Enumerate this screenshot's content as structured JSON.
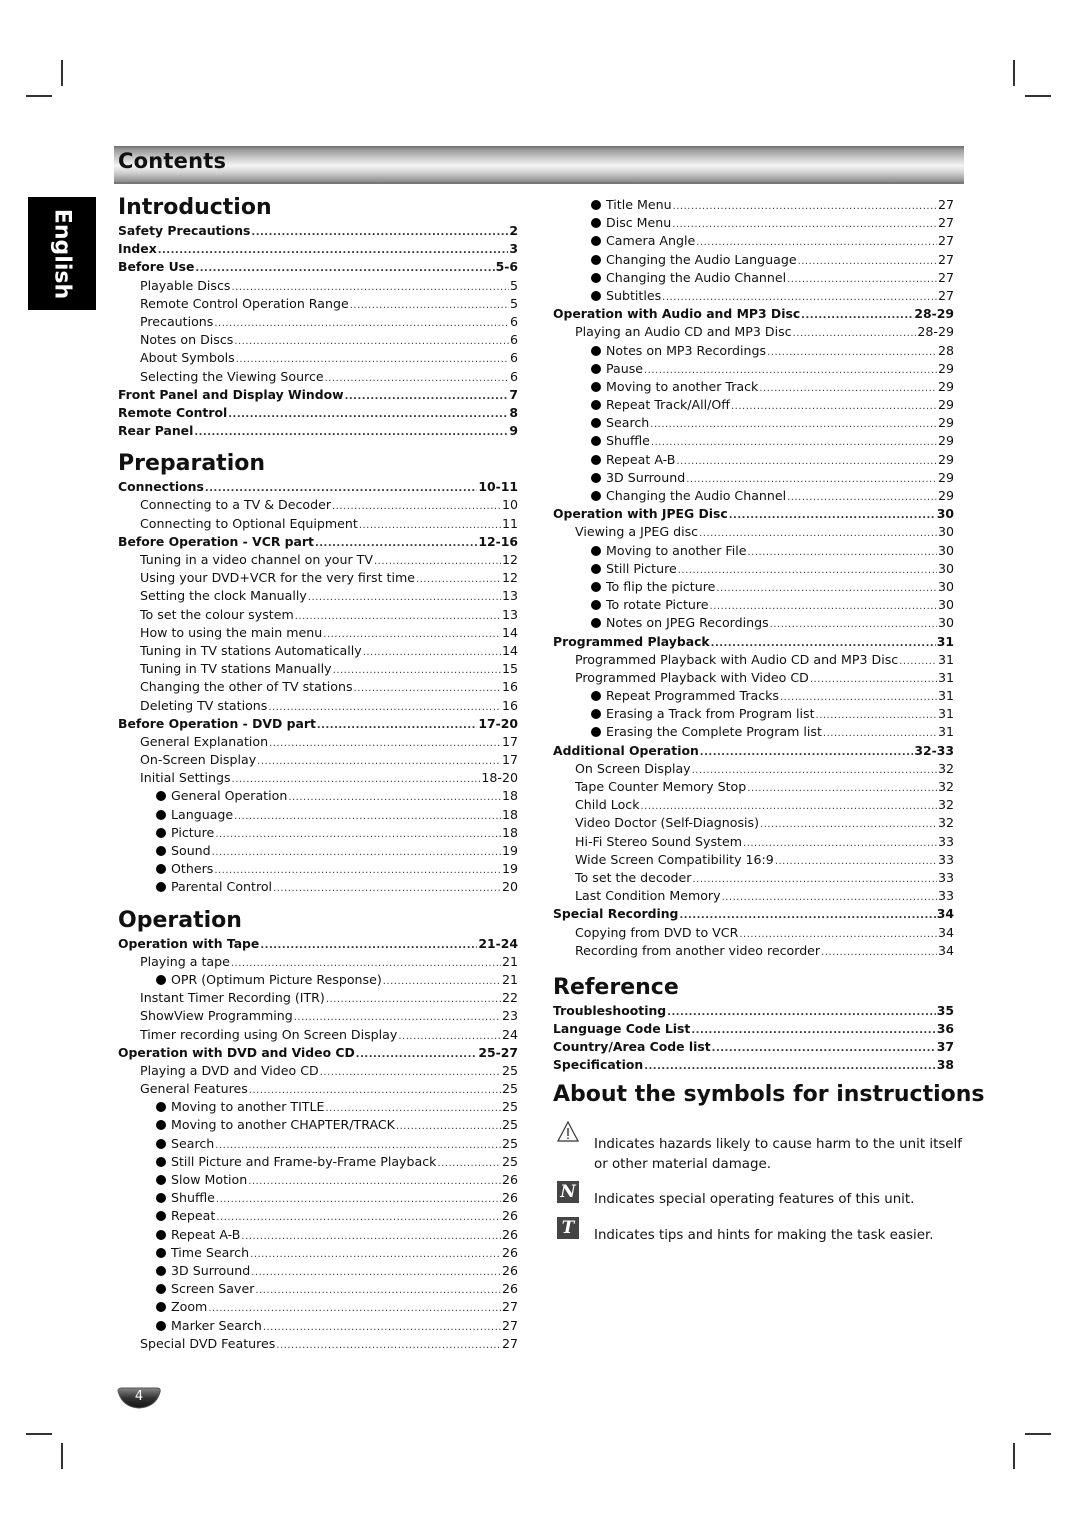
{
  "header": {
    "title": "Contents"
  },
  "language_tab": "English",
  "left_column": [
    {
      "type": "section",
      "text": "Introduction"
    },
    {
      "level": 0,
      "label": "Safety Precautions",
      "page": "2"
    },
    {
      "level": 0,
      "label": "Index",
      "page": "3"
    },
    {
      "level": 0,
      "label": "Before Use",
      "page": "5-6"
    },
    {
      "level": 1,
      "label": "Playable Discs",
      "page": "5"
    },
    {
      "level": 1,
      "label": "Remote Control Operation Range",
      "page": "5"
    },
    {
      "level": 1,
      "label": "Precautions",
      "page": "6"
    },
    {
      "level": 1,
      "label": "Notes on Discs",
      "page": "6"
    },
    {
      "level": 1,
      "label": "About Symbols",
      "page": "6"
    },
    {
      "level": 1,
      "label": "Selecting the Viewing Source",
      "page": "6"
    },
    {
      "level": 0,
      "label": "Front Panel and Display Window",
      "page": "7"
    },
    {
      "level": 0,
      "label": "Remote Control",
      "page": "8"
    },
    {
      "level": 0,
      "label": "Rear Panel",
      "page": "9"
    },
    {
      "type": "section",
      "text": "Preparation"
    },
    {
      "level": 0,
      "label": "Connections",
      "page": "10-11"
    },
    {
      "level": 1,
      "label": "Connecting to a TV & Decoder",
      "page": "10"
    },
    {
      "level": 1,
      "label": "Connecting to Optional Equipment",
      "page": "11"
    },
    {
      "level": 0,
      "label": "Before Operation - VCR part",
      "page": "12-16"
    },
    {
      "level": 1,
      "label": "Tuning in a video channel on your TV",
      "page": "12"
    },
    {
      "level": 1,
      "label": "Using your DVD+VCR for the very first time",
      "page": "12"
    },
    {
      "level": 1,
      "label": "Setting the clock Manually",
      "page": "13"
    },
    {
      "level": 1,
      "label": "To set the colour system",
      "page": "13"
    },
    {
      "level": 1,
      "label": "How to using the main menu",
      "page": "14"
    },
    {
      "level": 1,
      "label": "Tuning in TV stations Automatically",
      "page": "14"
    },
    {
      "level": 1,
      "label": "Tuning in TV stations Manually",
      "page": "15"
    },
    {
      "level": 1,
      "label": "Changing the other of TV stations",
      "page": "16"
    },
    {
      "level": 1,
      "label": "Deleting TV stations",
      "page": "16"
    },
    {
      "level": 0,
      "label": "Before Operation - DVD part",
      "page": "17-20"
    },
    {
      "level": 1,
      "label": "General Explanation",
      "page": "17"
    },
    {
      "level": 1,
      "label": "On-Screen Display",
      "page": "17"
    },
    {
      "level": 1,
      "label": "Initial Settings",
      "page": "18-20"
    },
    {
      "level": 2,
      "label": "General Operation",
      "page": "18"
    },
    {
      "level": 2,
      "label": "Language",
      "page": "18"
    },
    {
      "level": 2,
      "label": "Picture",
      "page": "18"
    },
    {
      "level": 2,
      "label": "Sound",
      "page": "19"
    },
    {
      "level": 2,
      "label": "Others",
      "page": "19"
    },
    {
      "level": 2,
      "label": "Parental Control",
      "page": "20"
    },
    {
      "type": "section",
      "text": "Operation"
    },
    {
      "level": 0,
      "label": "Operation with Tape",
      "page": "21-24"
    },
    {
      "level": 1,
      "label": "Playing a tape",
      "page": "21"
    },
    {
      "level": 2,
      "label": "OPR (Optimum Picture Response)",
      "page": "21"
    },
    {
      "level": 1,
      "label": "Instant Timer Recording (ITR)",
      "page": "22"
    },
    {
      "level": 1,
      "label": "ShowView Programming",
      "page": "23"
    },
    {
      "level": 1,
      "label": "Timer recording using On Screen Display",
      "page": "24"
    },
    {
      "level": 0,
      "label": "Operation with DVD and Video CD",
      "page": "25-27"
    },
    {
      "level": 1,
      "label": "Playing a DVD and Video CD",
      "page": "25"
    },
    {
      "level": 1,
      "label": "General Features",
      "page": "25"
    },
    {
      "level": 2,
      "label": "Moving to another TITLE",
      "page": "25"
    },
    {
      "level": 2,
      "label": "Moving to another CHAPTER/TRACK",
      "page": "25"
    },
    {
      "level": 2,
      "label": "Search",
      "page": "25"
    },
    {
      "level": 2,
      "label": "Still Picture and Frame-by-Frame Playback",
      "page": "25"
    },
    {
      "level": 2,
      "label": "Slow Motion",
      "page": "26"
    },
    {
      "level": 2,
      "label": "Shuffle",
      "page": "26"
    },
    {
      "level": 2,
      "label": "Repeat",
      "page": "26"
    },
    {
      "level": 2,
      "label": "Repeat A-B",
      "page": "26"
    },
    {
      "level": 2,
      "label": "Time Search",
      "page": "26"
    },
    {
      "level": 2,
      "label": "3D Surround",
      "page": "26"
    },
    {
      "level": 2,
      "label": "Screen Saver",
      "page": "26"
    },
    {
      "level": 2,
      "label": "Zoom",
      "page": "27"
    },
    {
      "level": 2,
      "label": "Marker Search",
      "page": "27"
    },
    {
      "level": 1,
      "label": "Special DVD Features",
      "page": "27"
    }
  ],
  "right_column": [
    {
      "level": 2,
      "label": "Title Menu",
      "page": "27"
    },
    {
      "level": 2,
      "label": "Disc Menu",
      "page": "27"
    },
    {
      "level": 2,
      "label": "Camera Angle",
      "page": "27"
    },
    {
      "level": 2,
      "label": "Changing the Audio Language",
      "page": "27"
    },
    {
      "level": 2,
      "label": "Changing the Audio Channel",
      "page": "27"
    },
    {
      "level": 2,
      "label": "Subtitles",
      "page": "27"
    },
    {
      "level": 0,
      "label": "Operation with Audio and MP3 Disc",
      "page": "28-29"
    },
    {
      "level": 1,
      "label": "Playing an Audio CD and MP3 Disc",
      "page": "28-29"
    },
    {
      "level": 2,
      "label": "Notes on MP3 Recordings",
      "page": "28"
    },
    {
      "level": 2,
      "label": "Pause",
      "page": "29"
    },
    {
      "level": 2,
      "label": "Moving to another Track",
      "page": "29"
    },
    {
      "level": 2,
      "label": "Repeat Track/All/Off",
      "page": "29"
    },
    {
      "level": 2,
      "label": "Search",
      "page": "29"
    },
    {
      "level": 2,
      "label": "Shuffle",
      "page": "29"
    },
    {
      "level": 2,
      "label": "Repeat A-B",
      "page": "29"
    },
    {
      "level": 2,
      "label": "3D Surround",
      "page": "29"
    },
    {
      "level": 2,
      "label": "Changing the Audio Channel",
      "page": "29"
    },
    {
      "level": 0,
      "label": "Operation with JPEG Disc",
      "page": "30"
    },
    {
      "level": 1,
      "label": "Viewing a JPEG disc",
      "page": "30"
    },
    {
      "level": 2,
      "label": "Moving to another File",
      "page": "30"
    },
    {
      "level": 2,
      "label": "Still Picture",
      "page": "30"
    },
    {
      "level": 2,
      "label": "To flip the picture",
      "page": "30"
    },
    {
      "level": 2,
      "label": "To rotate Picture",
      "page": "30"
    },
    {
      "level": 2,
      "label": "Notes on JPEG Recordings",
      "page": "30"
    },
    {
      "level": 0,
      "label": "Programmed Playback",
      "page": "31"
    },
    {
      "level": 1,
      "label": "Programmed Playback with Audio CD and MP3 Disc",
      "page": "31"
    },
    {
      "level": 1,
      "label": "Programmed Playback with Video CD",
      "page": "31"
    },
    {
      "level": 2,
      "label": "Repeat Programmed Tracks",
      "page": "31"
    },
    {
      "level": 2,
      "label": "Erasing a Track from Program list",
      "page": "31"
    },
    {
      "level": 2,
      "label": "Erasing the Complete Program list",
      "page": "31"
    },
    {
      "level": 0,
      "label": "Additional Operation",
      "page": "32-33"
    },
    {
      "level": 1,
      "label": "On Screen Display",
      "page": "32"
    },
    {
      "level": 1,
      "label": "Tape Counter Memory Stop",
      "page": "32"
    },
    {
      "level": 1,
      "label": "Child Lock",
      "page": "32"
    },
    {
      "level": 1,
      "label": "Video Doctor (Self-Diagnosis)",
      "page": "32"
    },
    {
      "level": 1,
      "label": "Hi-Fi Stereo Sound System",
      "page": "33"
    },
    {
      "level": 1,
      "label": "Wide Screen Compatibility 16:9",
      "page": "33"
    },
    {
      "level": 1,
      "label": "To set the decoder",
      "page": "33"
    },
    {
      "level": 1,
      "label": "Last Condition Memory",
      "page": "33"
    },
    {
      "level": 0,
      "label": "Special Recording",
      "page": "34"
    },
    {
      "level": 1,
      "label": "Copying from DVD to VCR",
      "page": "34"
    },
    {
      "level": 1,
      "label": "Recording from another video recorder",
      "page": "34"
    },
    {
      "type": "gap"
    },
    {
      "type": "section",
      "text": "Reference"
    },
    {
      "level": 0,
      "label": "Troubleshooting",
      "page": "35"
    },
    {
      "level": 0,
      "label": "Language Code List",
      "page": "36"
    },
    {
      "level": 0,
      "label": "Country/Area Code list",
      "page": "37"
    },
    {
      "level": 0,
      "label": "Specification",
      "page": "38"
    }
  ],
  "symbols": {
    "title": "About the symbols for instructions",
    "items": [
      {
        "icon": "warning-triangle-icon",
        "glyph": "",
        "text": "Indicates hazards likely to cause harm to the unit itself or other material damage."
      },
      {
        "icon": "note-icon",
        "glyph": "N",
        "text": "Indicates special operating features of this unit."
      },
      {
        "icon": "tip-icon",
        "glyph": "T",
        "text": "Indicates tips and hints for making the task easier."
      }
    ]
  },
  "page_number": "4"
}
